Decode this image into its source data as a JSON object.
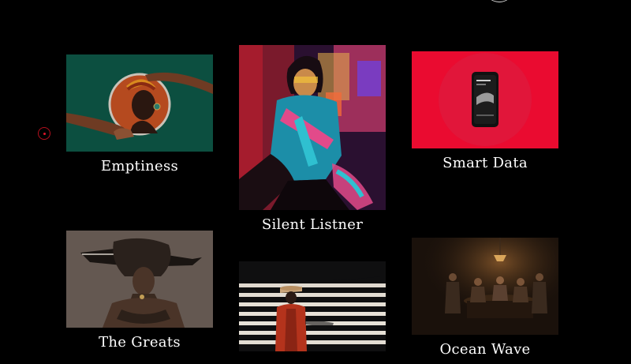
{
  "projects": [
    {
      "title": "Emptiness"
    },
    {
      "title": "Silent Listner"
    },
    {
      "title": "Smart Data"
    },
    {
      "title": "The Greats"
    },
    {
      "title": "Ocean Wave"
    }
  ],
  "colors": {
    "background": "#000000",
    "accent": "#e0142a"
  }
}
